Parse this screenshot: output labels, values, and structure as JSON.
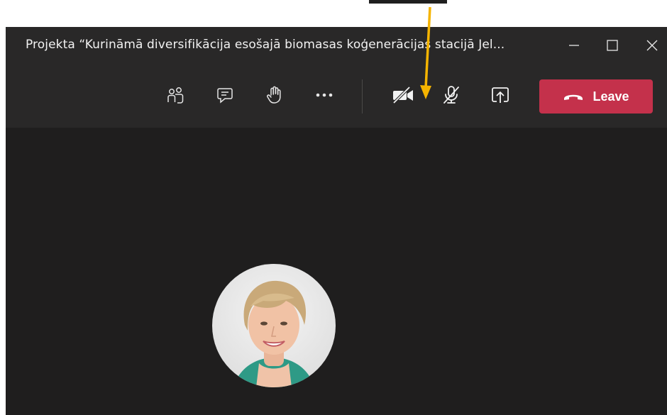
{
  "window": {
    "title": "Projekta “Kurināmā diversifikācija esošajā biomasas koģenerācijas stacijā Jel..."
  },
  "toolbar": {
    "leave_label": "Leave"
  },
  "icons": {
    "participants": "people-icon",
    "chat": "chat-icon",
    "raise_hand": "hand-icon",
    "more": "more-icon",
    "camera": "camera-off-icon",
    "mic": "mic-off-icon",
    "share": "share-screen-icon",
    "leave": "phone-hangup-icon",
    "minimize": "minimize-icon",
    "maximize": "maximize-icon",
    "close": "close-icon"
  },
  "colors": {
    "leave_button": "#c4314b",
    "annotation_arrow": "#f5b400",
    "titlebar": "#292828",
    "stage": "#1f1e1e"
  }
}
